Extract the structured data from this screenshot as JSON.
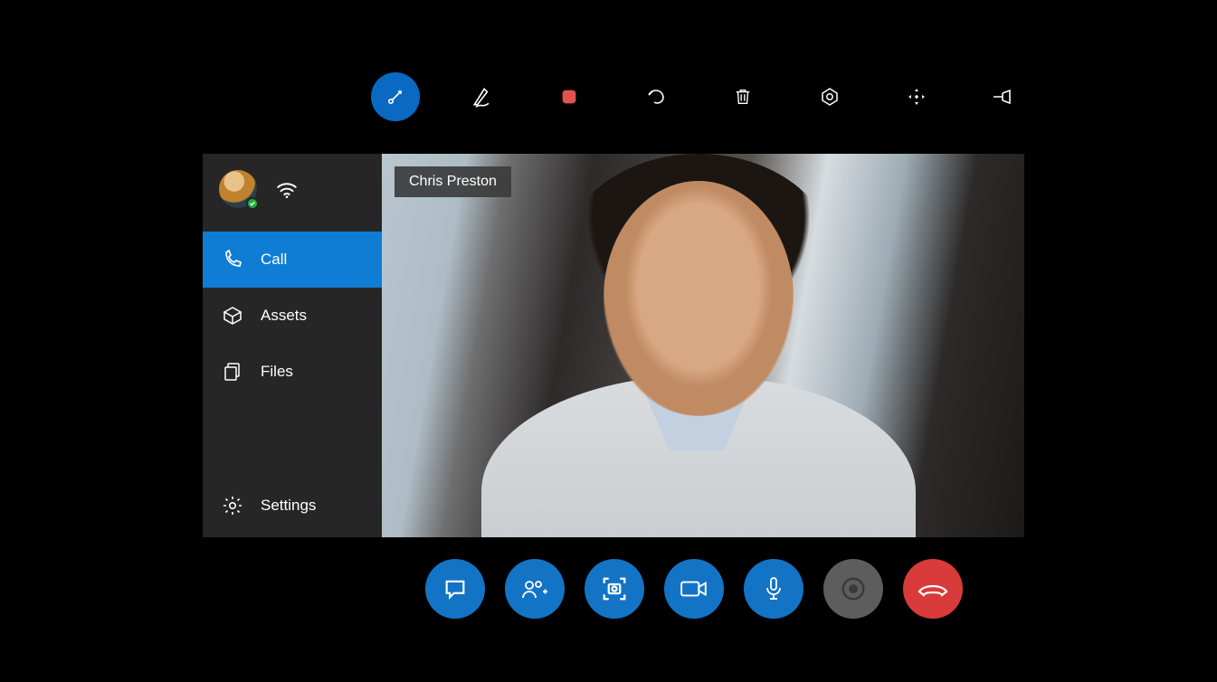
{
  "participant": {
    "name": "Chris Preston"
  },
  "sidebar": {
    "items": [
      {
        "label": "Call",
        "icon": "phone-icon",
        "active": true
      },
      {
        "label": "Assets",
        "icon": "box-icon",
        "active": false
      },
      {
        "label": "Files",
        "icon": "files-icon",
        "active": false
      }
    ],
    "settings_label": "Settings"
  },
  "top_toolbar": {
    "items": [
      {
        "name": "pointer-tool-icon",
        "active": true
      },
      {
        "name": "pen-tool-icon",
        "active": false
      },
      {
        "name": "record-icon",
        "active": false
      },
      {
        "name": "undo-icon",
        "active": false
      },
      {
        "name": "trash-icon",
        "active": false
      },
      {
        "name": "lens-icon",
        "active": false
      },
      {
        "name": "move-icon",
        "active": false
      },
      {
        "name": "pin-icon",
        "active": false
      }
    ]
  },
  "call_controls": {
    "items": [
      {
        "name": "chat-button",
        "icon": "chat-icon",
        "style": "blue"
      },
      {
        "name": "add-person-button",
        "icon": "add-person-icon",
        "style": "blue"
      },
      {
        "name": "screenshot-button",
        "icon": "camera-frame-icon",
        "style": "blue"
      },
      {
        "name": "video-button",
        "icon": "video-icon",
        "style": "blue"
      },
      {
        "name": "mic-button",
        "icon": "mic-icon",
        "style": "blue"
      },
      {
        "name": "record-button",
        "icon": "circle-dot-icon",
        "style": "grey"
      },
      {
        "name": "hangup-button",
        "icon": "hangup-icon",
        "style": "red"
      }
    ]
  },
  "colors": {
    "accent_blue": "#1374c6",
    "hangup_red": "#d93a3a",
    "record_red": "#e1524f",
    "sidebar_bg": "#262626"
  }
}
